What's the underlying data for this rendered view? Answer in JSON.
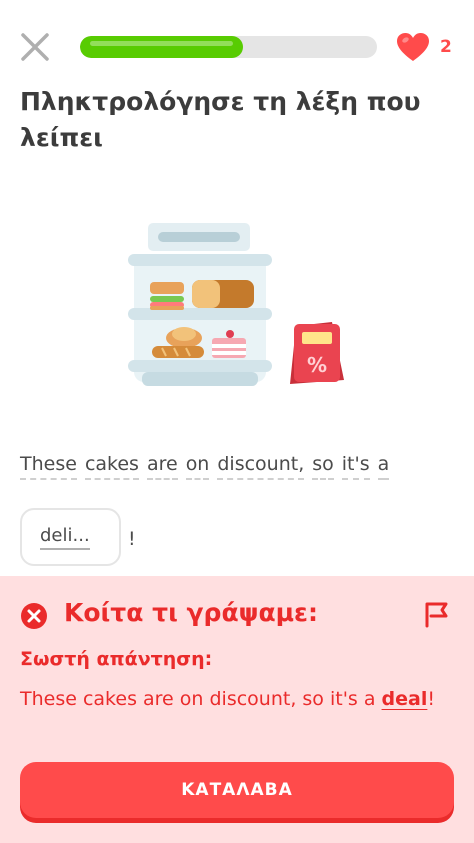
{
  "header": {
    "close_icon": "close-icon",
    "progress": 0.55,
    "progress_color": "#58cc02",
    "hearts": "2",
    "heart_color": "#ff4b4b"
  },
  "prompt": {
    "title": "Πληκτρολόγησε τη λέξη που λείπει"
  },
  "illustration": {
    "icon": "bakery-display-case-illustration"
  },
  "exercise": {
    "words": [
      "These",
      "cakes",
      "are",
      "on",
      "discount,",
      "so",
      "it's",
      "a"
    ],
    "typed_value": "deli...",
    "trailing": "!"
  },
  "feedback": {
    "status_icon": "error-x-icon",
    "title": "Κοίτα τι γράψαμε:",
    "subtitle": "Σωστή απάντηση:",
    "answer_prefix": "These cakes are on discount, so it's a ",
    "answer_highlight": "deal",
    "answer_suffix": "!",
    "panel_color": "#ffdfe0",
    "text_color": "#ea2b2b",
    "flag_icon": "flag-icon"
  },
  "footer": {
    "continue_label": "ΚΑΤΑΛΑΒΑ",
    "button_color": "#ff4b4b"
  }
}
